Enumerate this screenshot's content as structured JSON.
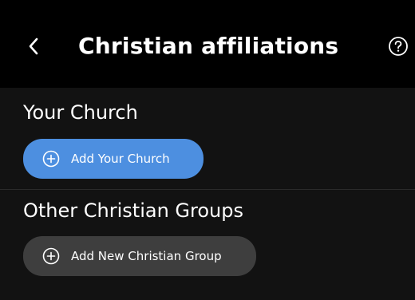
{
  "header": {
    "title": "Christian affiliations",
    "back_icon": "chevron-left-icon",
    "help_icon": "question-circle-icon"
  },
  "sections": {
    "church": {
      "title": "Your Church",
      "button_label": "Add Your Church",
      "button_icon": "plus-circle-icon",
      "button_color": "#4d8fe0"
    },
    "groups": {
      "title": "Other Christian Groups",
      "button_label": "Add New Christian Group",
      "button_icon": "plus-circle-icon",
      "button_color": "#3e3e3e"
    }
  },
  "colors": {
    "header_bg": "#000000",
    "body_bg": "#121212",
    "text": "#ffffff"
  }
}
